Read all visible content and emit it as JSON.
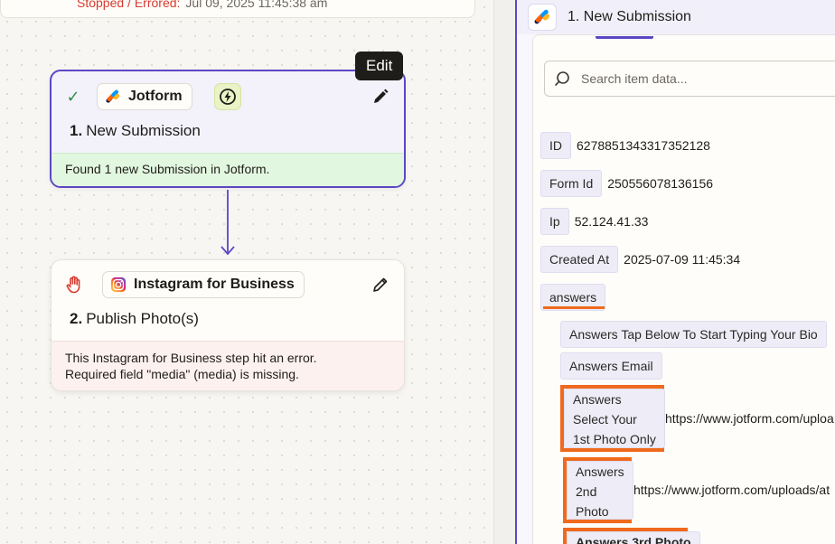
{
  "canvas": {
    "top_card": {
      "status": "Stopped / Errored:",
      "timestamp": "Jul 09, 2025 11:45:38 am"
    },
    "tooltip": "Edit",
    "step1": {
      "app": "Jotform",
      "number": "1.",
      "title": "New Submission",
      "message": "Found 1 new Submission in Jotform."
    },
    "step2": {
      "app": "Instagram for Business",
      "number": "2.",
      "title": "Publish Photo(s)",
      "error_line1": "This Instagram for Business step hit an error.",
      "error_line2": "Required field \"media\" (media) is missing."
    }
  },
  "panel": {
    "title": "1. New Submission",
    "search_placeholder": "Search item data...",
    "fields": [
      {
        "key": "ID",
        "value": "6278851343317352128"
      },
      {
        "key": "Form Id",
        "value": "250556078136156"
      },
      {
        "key": "Ip",
        "value": "52.124.41.33"
      },
      {
        "key": "Created At",
        "value": "2025-07-09 11:45:34"
      }
    ],
    "answers": {
      "label": "answers",
      "items": [
        {
          "key": "Answers Tap Below To Start Typing Your Bio",
          "value": ""
        },
        {
          "key": "Answers Email",
          "value": ""
        },
        {
          "key_lines": [
            "Answers",
            "Select Your",
            "1st Photo Only"
          ],
          "value": "https://www.jotform.com/uploa"
        },
        {
          "key_lines": [
            "Answers",
            "2nd",
            "Photo"
          ],
          "value": "https://www.jotform.com/uploads/at"
        },
        {
          "key": "Answers 3rd Photo",
          "value": ""
        }
      ]
    }
  },
  "colors": {
    "accent": "#5b47c4",
    "highlight": "#f06a1d",
    "success": "#2f8f46",
    "error": "#d63a2f"
  }
}
